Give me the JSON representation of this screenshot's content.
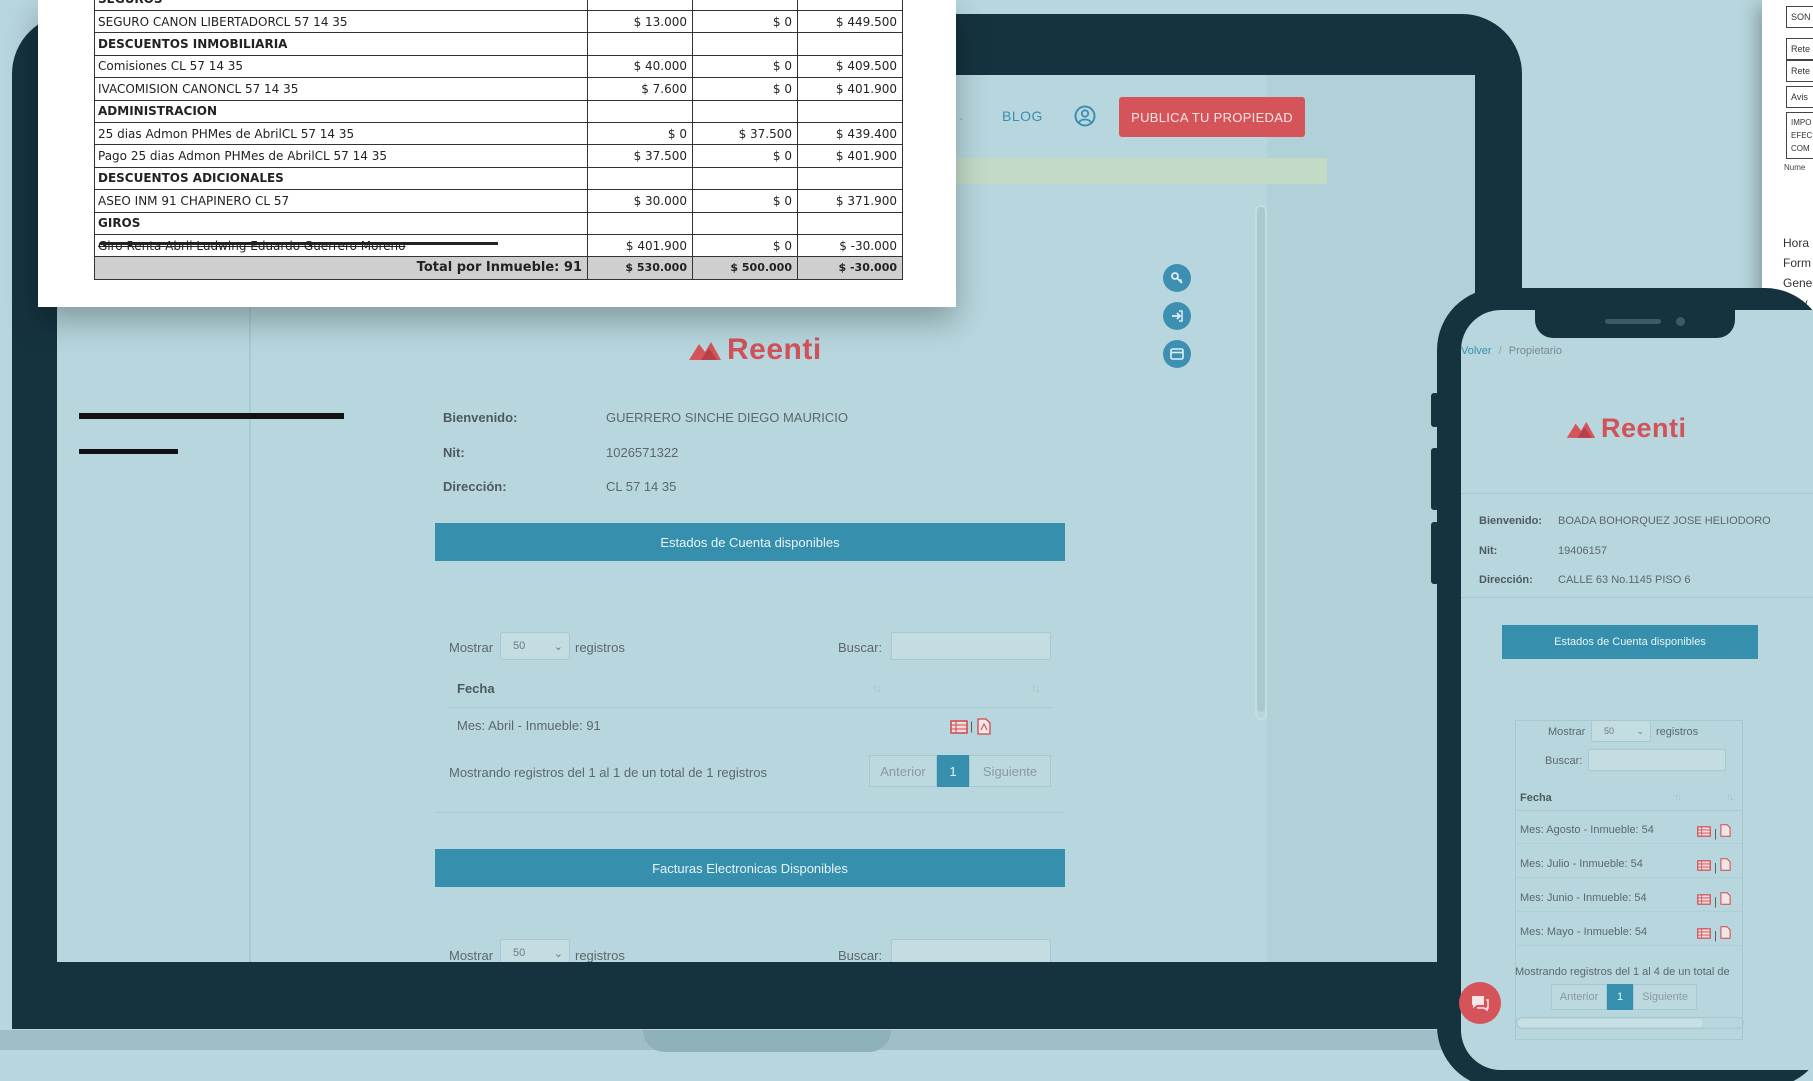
{
  "colors": {
    "background": "#b7d6de",
    "device": "#15333f",
    "accent_blue": "#3690ad",
    "brand_red": "#d4545a"
  },
  "statement": {
    "top_partial_label": "SEGUROS",
    "rows": [
      {
        "concept": "SEGURO CANON LIBERTADORCL 57 14 35",
        "debit": "$ 13.000",
        "credit": "$ 0",
        "balance": "$ 449.500"
      },
      {
        "header": "DESCUENTOS INMOBILIARIA"
      },
      {
        "concept": "Comisiones CL 57 14 35",
        "debit": "$ 40.000",
        "credit": "$ 0",
        "balance": "$ 409.500"
      },
      {
        "concept": "IVACOMISION CANONCL 57 14 35",
        "debit": "$ 7.600",
        "credit": "$ 0",
        "balance": "$ 401.900"
      },
      {
        "header": "ADMINISTRACION"
      },
      {
        "concept": "25 dias Admon PHMes de AbrilCL 57 14 35",
        "debit": "$ 0",
        "credit": "$ 37.500",
        "balance": "$ 439.400"
      },
      {
        "concept": "Pago 25 dias Admon PHMes de AbrilCL 57 14 35",
        "debit": "$ 37.500",
        "credit": "$ 0",
        "balance": "$ 401.900"
      },
      {
        "header": "DESCUENTOS ADICIONALES"
      },
      {
        "concept": "ASEO INM 91 CHAPINERO CL 57",
        "debit": "$ 30.000",
        "credit": "$ 0",
        "balance": "$ 371.900"
      },
      {
        "header": "GIROS"
      },
      {
        "concept": "Giro Renta Abril Ludwing Eduardo Guerrero Moreno",
        "debit": "$ 401.900",
        "credit": "$ 0",
        "balance": "$ -30.000"
      }
    ],
    "total": {
      "label": "Total por Inmueble: 91",
      "debit": "$ 530.000",
      "credit": "$ 500.000",
      "balance": "$ -30.000"
    }
  },
  "laptop": {
    "nav": {
      "blog": "BLOG",
      "publish": "PUBLICA TU PROPIEDAD"
    },
    "logo": "Reenti",
    "info": {
      "welcome_label": "Bienvenido:",
      "welcome_value": "GUERRERO SINCHE DIEGO MAURICIO",
      "nit_label": "Nit:",
      "nit_value": "1026571322",
      "address_label": "Dirección:",
      "address_value": "CL 57 14 35"
    },
    "statements_button": "Estados de Cuenta disponibles",
    "table": {
      "show_label": "Mostrar",
      "show_value": "50",
      "records_label": "registros",
      "search_label": "Buscar:",
      "column_date": "Fecha",
      "rows": [
        "Mes: Abril - Inmueble: 91"
      ],
      "summary": "Mostrando registros del 1 al 1 de un total de 1 registros",
      "prev": "Anterior",
      "page": "1",
      "next": "Siguiente"
    },
    "invoices_button": "Facturas Electronicas Disponibles",
    "table2": {
      "show_label": "Mostrar",
      "show_value": "50",
      "records_label": "registros",
      "search_label": "Buscar:"
    }
  },
  "phone": {
    "breadcrumb": {
      "back": "Volver",
      "sep": "/",
      "current": "Propietario"
    },
    "logo": "Reenti",
    "info": {
      "welcome_label": "Bienvenido:",
      "welcome_value": "BOADA BOHORQUEZ JOSE HELIODORO",
      "nit_label": "Nit:",
      "nit_value": "19406157",
      "address_label": "Dirección:",
      "address_value": "CALLE 63 No.1145 PISO 6"
    },
    "statements_button": "Estados de Cuenta disponibles",
    "table": {
      "show_label": "Mostrar",
      "show_value": "50",
      "records_label": "registros",
      "search_label": "Buscar:",
      "column_date": "Fecha",
      "rows": [
        "Mes: Agosto - Inmueble: 54",
        "Mes: Julio - Inmueble: 54",
        "Mes: Junio - Inmueble: 54",
        "Mes: Mayo - Inmueble: 54"
      ],
      "summary": "Mostrando registros del 1 al 4 de un total de",
      "prev": "Anterior",
      "page": "1",
      "next": "Siguiente"
    }
  },
  "side_doc": {
    "cells": [
      "SON",
      "Rete",
      "Rete",
      "Avis",
      "IMPO",
      "EFEC",
      "COM"
    ],
    "small": "Nume",
    "lines": [
      "Hora",
      "Form",
      "Gene",
      "Prov"
    ]
  }
}
